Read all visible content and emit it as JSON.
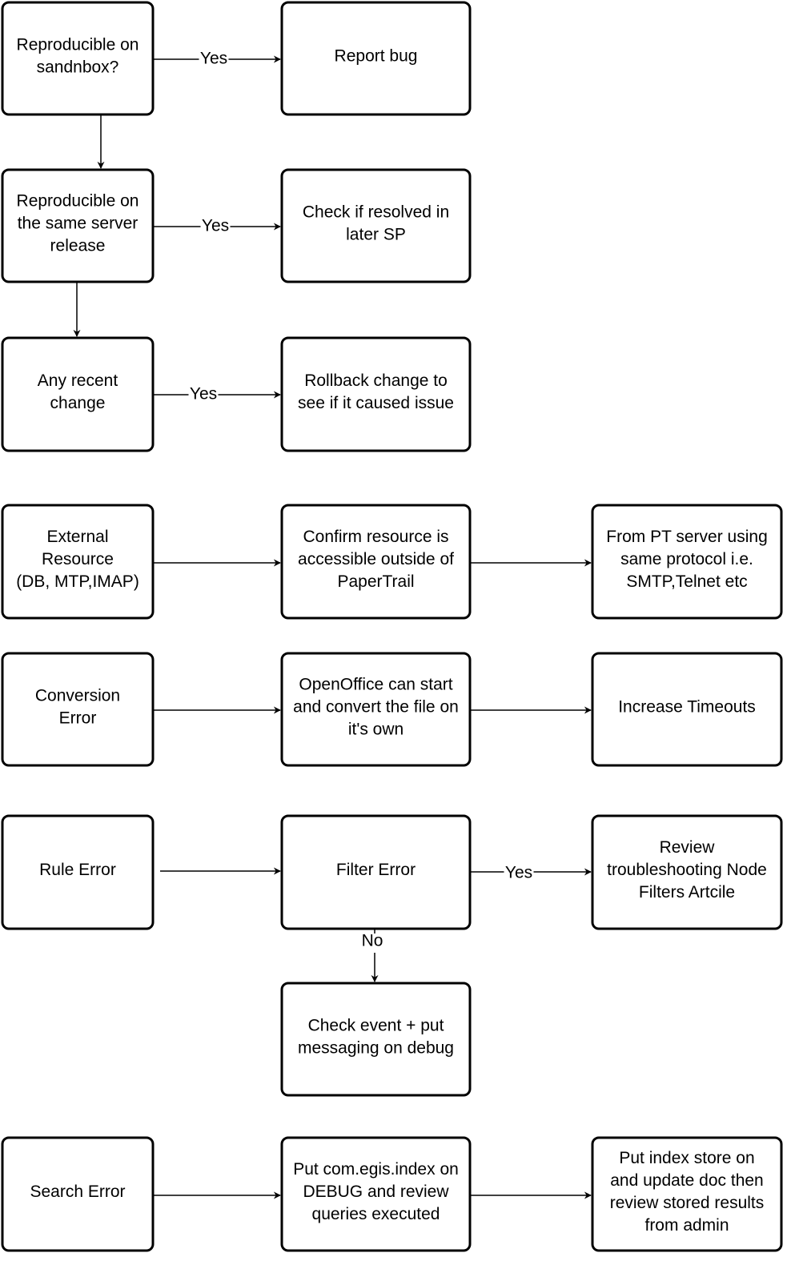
{
  "nodes": [
    {
      "id": "sandbox",
      "lines": [
        "Reproducible on",
        "sandnbox?"
      ]
    },
    {
      "id": "report-bug",
      "lines": [
        "Report bug"
      ]
    },
    {
      "id": "same-release",
      "lines": [
        "Reproducible on",
        "the same server",
        "release"
      ]
    },
    {
      "id": "check-sp",
      "lines": [
        "Check if resolved in",
        "later SP"
      ]
    },
    {
      "id": "recent-change",
      "lines": [
        "Any recent",
        "change"
      ]
    },
    {
      "id": "rollback",
      "lines": [
        "Rollback change to",
        "see if it caused issue"
      ]
    },
    {
      "id": "external-resource",
      "lines": [
        "External",
        "Resource",
        "(DB, MTP,IMAP)"
      ]
    },
    {
      "id": "confirm-resource",
      "lines": [
        "Confirm resource is",
        "accessible outside of",
        "PaperTrail"
      ]
    },
    {
      "id": "from-pt-server",
      "lines": [
        "From PT server using",
        "same protocol i.e.",
        "SMTP,Telnet etc"
      ]
    },
    {
      "id": "conversion-error",
      "lines": [
        "Conversion",
        "Error"
      ]
    },
    {
      "id": "openoffice",
      "lines": [
        "OpenOffice can start",
        "and convert the file on",
        "it's own"
      ]
    },
    {
      "id": "increase-timeouts",
      "lines": [
        "Increase Timeouts"
      ]
    },
    {
      "id": "rule-error",
      "lines": [
        "Rule Error"
      ]
    },
    {
      "id": "filter-error",
      "lines": [
        "Filter Error"
      ]
    },
    {
      "id": "review-filters",
      "lines": [
        "Review",
        "troubleshooting Node",
        "Filters Artcile"
      ]
    },
    {
      "id": "check-event",
      "lines": [
        "Check event + put",
        "messaging on debug"
      ]
    },
    {
      "id": "search-error",
      "lines": [
        "Search Error"
      ]
    },
    {
      "id": "index-debug",
      "lines": [
        "Put com.egis.index on",
        "DEBUG and review",
        "queries executed"
      ]
    },
    {
      "id": "index-store",
      "lines": [
        "Put index store on",
        "and update doc then",
        "review stored results",
        "from admin"
      ]
    }
  ],
  "edges": [
    {
      "from": "sandbox",
      "to": "report-bug",
      "label": "Yes"
    },
    {
      "from": "sandbox",
      "to": "same-release",
      "label": ""
    },
    {
      "from": "same-release",
      "to": "check-sp",
      "label": "Yes"
    },
    {
      "from": "same-release",
      "to": "recent-change",
      "label": ""
    },
    {
      "from": "recent-change",
      "to": "rollback",
      "label": "Yes"
    },
    {
      "from": "external-resource",
      "to": "confirm-resource",
      "label": ""
    },
    {
      "from": "confirm-resource",
      "to": "from-pt-server",
      "label": ""
    },
    {
      "from": "conversion-error",
      "to": "openoffice",
      "label": ""
    },
    {
      "from": "openoffice",
      "to": "increase-timeouts",
      "label": ""
    },
    {
      "from": "rule-error",
      "to": "filter-error",
      "label": ""
    },
    {
      "from": "filter-error",
      "to": "review-filters",
      "label": "Yes"
    },
    {
      "from": "filter-error",
      "to": "check-event",
      "label": "No"
    },
    {
      "from": "search-error",
      "to": "index-debug",
      "label": ""
    },
    {
      "from": "index-debug",
      "to": "index-store",
      "label": ""
    }
  ]
}
